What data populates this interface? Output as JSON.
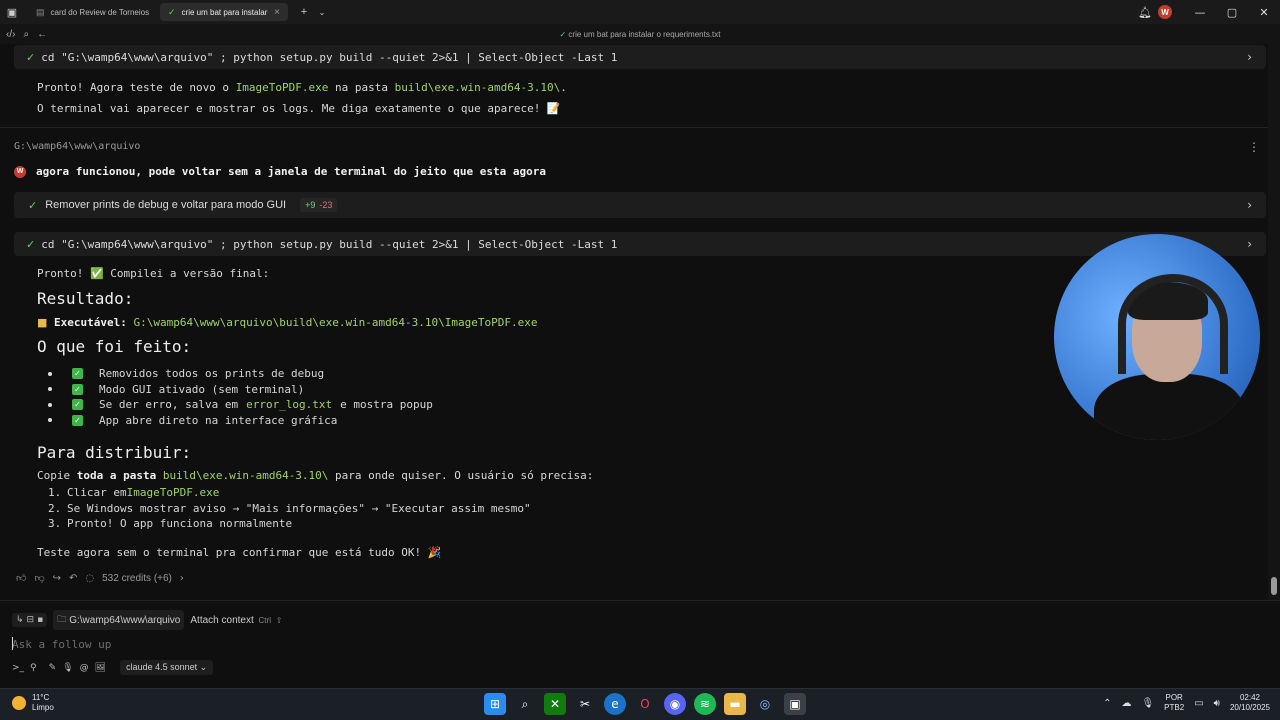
{
  "tabs": [
    {
      "label": "card do Review de Torneios",
      "active": false
    },
    {
      "label": "crie um bat para instalar o requeriments.txt",
      "active": true
    }
  ],
  "window_title": "crie um bat para instalar o requeriments.txt",
  "user_initial": "W",
  "commands": [
    "cd \"G:\\wamp64\\www\\arquivo\" ; python setup.py build --quiet 2>&1 | Select-Object -Last 1",
    "cd \"G:\\wamp64\\www\\arquivo\" ; python setup.py build --quiet 2>&1 | Select-Object -Last 1"
  ],
  "msg1": {
    "a": "Pronto! Agora teste de novo o ",
    "exe": "ImageToPDF.exe",
    "b": " na pasta ",
    "folder": "build\\exe.win-amd64-3.10\\",
    "c": ".",
    "line2": "O terminal vai aparecer e mostrar os logs. Me diga exatamente o que aparece! 📝"
  },
  "cwd": "G:\\wamp64\\www\\arquivo",
  "user_message": "agora funcionou, pode voltar sem a janela de terminal do jeito que esta agora",
  "edit": {
    "label": "Remover prints de debug e voltar para modo GUI",
    "added": "+9",
    "removed": "-23"
  },
  "response": {
    "intro": "Pronto! ✅ Compilei a versão final:",
    "h_result": "Resultado:",
    "exe_label": "Executável:",
    "exe_path": "G:\\wamp64\\www\\arquivo\\build\\exe.win-amd64-3.10\\ImageToPDF.exe",
    "h_done": "O que foi feito:",
    "bullets": [
      {
        "text": "Removidos todos os prints de debug"
      },
      {
        "text": "Modo GUI ativado (sem terminal)"
      },
      {
        "pre": "Se der erro, salva em ",
        "code": "error_log.txt",
        "post": " e mostra popup"
      },
      {
        "text": "App abre direto na interface gráfica"
      }
    ],
    "h_dist": "Para distribuir:",
    "dist_a": "Copie ",
    "dist_bold": "toda a pasta",
    "dist_b": " ",
    "dist_code": "build\\exe.win-amd64-3.10\\",
    "dist_c": " para onde quiser. O usuário só precisa:",
    "steps": [
      {
        "n": "1.",
        "pre": "Clicar em ",
        "code": "ImageToPDF.exe"
      },
      {
        "n": "2.",
        "pre": "Se Windows mostrar aviso → \"Mais informações\" → \"Executar assim mesmo\"",
        "code": ""
      },
      {
        "n": "3.",
        "pre": "Pronto! O app funciona normalmente",
        "code": ""
      }
    ],
    "closing": "Teste agora sem o terminal pra confirmar que está tudo OK! 🎉"
  },
  "credits": "532 credits (+6)",
  "context": {
    "path": "G:\\wamp64\\www\\arquivo",
    "attach": "Attach context",
    "shortcut": "Ctrl"
  },
  "input": {
    "placeholder": "Ask a follow up"
  },
  "model": "claude 4.5 sonnet",
  "taskbar": {
    "temp": "11°C",
    "condition": "Limpo",
    "lang1": "POR",
    "lang2": "PTB2",
    "time": "02:42",
    "date": "20/10/2025"
  }
}
